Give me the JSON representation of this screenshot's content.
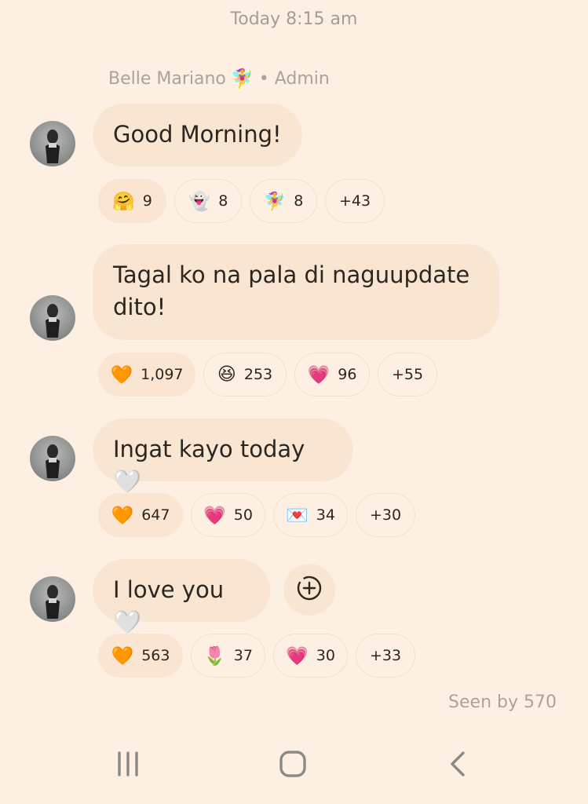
{
  "timestamp": "Today 8:15 am",
  "sender": {
    "name": "Belle Mariano",
    "emoji": "🧚‍♀️",
    "role": "• Admin"
  },
  "messages": [
    {
      "text": "Good Morning!",
      "reactions": [
        {
          "icon": "hugging-face-icon",
          "emoji": "🤗",
          "count": "9"
        },
        {
          "icon": "ghost-icon",
          "emoji": "👻",
          "count": "8"
        },
        {
          "icon": "fairy-icon",
          "emoji": "🧚‍♀️",
          "count": "8"
        },
        {
          "icon": "more-icon",
          "emoji": "",
          "count": "+43"
        }
      ]
    },
    {
      "text": "Tagal ko na pala di naguupdate dito!",
      "reactions": [
        {
          "icon": "orange-heart-icon",
          "emoji": "🧡",
          "count": "1,097"
        },
        {
          "icon": "grinning-squint-face-icon",
          "emoji": "😆",
          "count": "253"
        },
        {
          "icon": "sparkling-heart-icon",
          "emoji": "💗",
          "count": "96"
        },
        {
          "icon": "more-icon",
          "emoji": "",
          "count": "+55"
        }
      ]
    },
    {
      "text": "Ingat kayo today🤍",
      "reactions": [
        {
          "icon": "orange-heart-icon",
          "emoji": "🧡",
          "count": "647"
        },
        {
          "icon": "sparkling-heart-icon",
          "emoji": "💗",
          "count": "50"
        },
        {
          "icon": "love-letter-icon",
          "emoji": "💌",
          "count": "34"
        },
        {
          "icon": "more-icon",
          "emoji": "",
          "count": "+30"
        }
      ]
    },
    {
      "text": "I love you🤍",
      "reactions": [
        {
          "icon": "orange-heart-icon",
          "emoji": "🧡",
          "count": "563"
        },
        {
          "icon": "tulip-icon",
          "emoji": "🌷",
          "count": "37"
        },
        {
          "icon": "sparkling-heart-icon",
          "emoji": "💗",
          "count": "30"
        },
        {
          "icon": "more-icon",
          "emoji": "",
          "count": "+33"
        }
      ]
    }
  ],
  "seen_by": "Seen by 570",
  "colors": {
    "background": "#fdf0e2",
    "bubble": "#f8e6d3",
    "muted_text": "#aaa399"
  }
}
